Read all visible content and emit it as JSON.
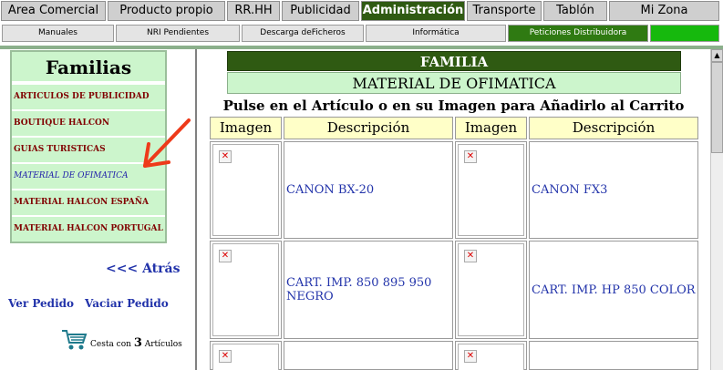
{
  "top_nav": [
    {
      "label": "Area Comercial"
    },
    {
      "label": "Producto propio"
    },
    {
      "label": "RR.HH"
    },
    {
      "label": "Publicidad"
    },
    {
      "label": "Administración"
    },
    {
      "label": "Transporte"
    },
    {
      "label": "Tablón"
    },
    {
      "label": "Mi Zona"
    }
  ],
  "sub_nav": [
    {
      "label": "Manuales"
    },
    {
      "label": "NRI Pendientes"
    },
    {
      "label": "Descarga deFicheros"
    },
    {
      "label": "Informática"
    },
    {
      "label": "Peticiones Distribuidora"
    },
    {
      "label": ""
    }
  ],
  "sidebar": {
    "title": "Familias",
    "items": [
      {
        "label": "ARTICULOS DE PUBLICIDAD"
      },
      {
        "label": "BOUTIQUE HALCON"
      },
      {
        "label": "GUIAS TURISTICAS"
      },
      {
        "label": "MATERIAL DE OFIMATICA"
      },
      {
        "label": "MATERIAL HALCON ESPAÑA"
      },
      {
        "label": "MATERIAL HALCON PORTUGAL"
      }
    ],
    "back": "<<< Atrás",
    "view_order": "Ver Pedido",
    "empty_order": "Vaciar Pedido",
    "cart": {
      "prefix": "Cesta con",
      "count": "3",
      "suffix": "Artículos"
    }
  },
  "main": {
    "section_header": "FAMILIA",
    "family_name": "MATERIAL DE OFIMATICA",
    "instruction": "Pulse en el Artículo o en su Imagen para Añadirlo al Carrito",
    "columns": [
      "Imagen",
      "Descripción",
      "Imagen",
      "Descripción"
    ],
    "rows": [
      [
        "CANON BX-20",
        "CANON FX3"
      ],
      [
        "CART. IMP. 850 895 950 NEGRO",
        "CART. IMP. HP 850 COLOR"
      ],
      [
        "",
        ""
      ]
    ]
  },
  "colors": {
    "active_tab": "#2f5a12",
    "family_bg": "#ccf5cc",
    "family_text": "#800000",
    "link": "#2233aa",
    "table_header_bg": "#ffffc8"
  }
}
